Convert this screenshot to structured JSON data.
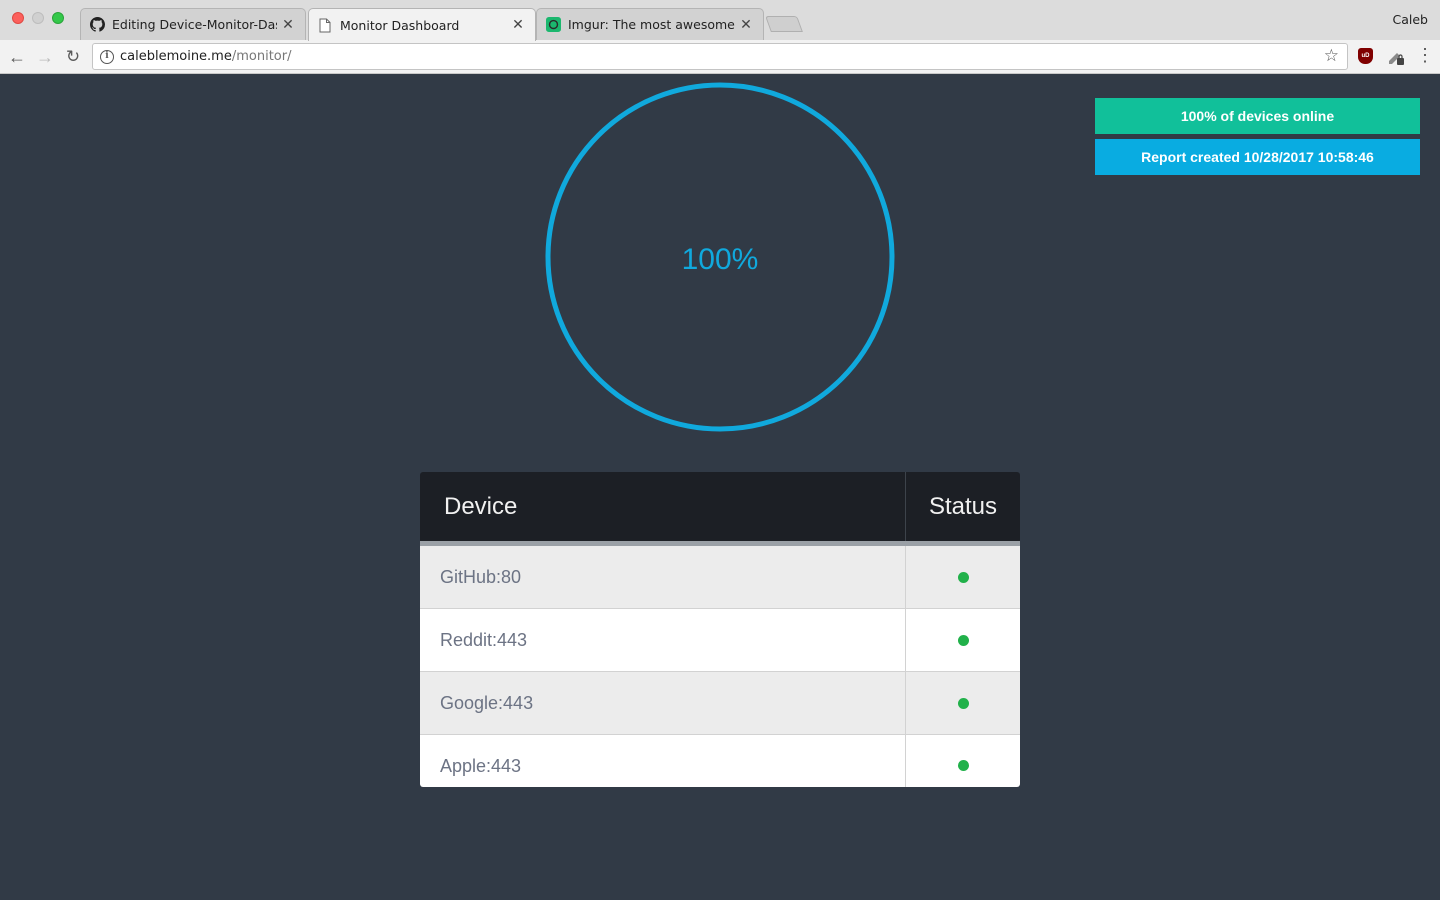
{
  "browser": {
    "tabs": [
      {
        "title": "Editing Device-Monitor-Dashboard",
        "icon": "github-icon",
        "active": false
      },
      {
        "title": "Monitor Dashboard",
        "icon": "document-icon",
        "active": true
      },
      {
        "title": "Imgur: The most awesome images on the Internet",
        "icon": "imgur-icon",
        "active": false
      }
    ],
    "profile_name": "Caleb",
    "url_host": "caleblemoine.me",
    "url_path": "/monitor/"
  },
  "dashboard": {
    "gauge_label": "100%",
    "online_fraction": 1.0,
    "online_badge": "100% of devices online",
    "report_badge": "Report created 10/28/2017 10:58:46",
    "colors": {
      "gauge": "#10a9dd",
      "online_badge": "#11c09a",
      "report_badge": "#09ace1",
      "status_ok": "#21b14a"
    }
  },
  "table": {
    "headers": {
      "device": "Device",
      "status": "Status"
    },
    "rows": [
      {
        "device": "GitHub:80",
        "status": "online"
      },
      {
        "device": "Reddit:443",
        "status": "online"
      },
      {
        "device": "Google:443",
        "status": "online"
      },
      {
        "device": "Apple:443",
        "status": "online"
      }
    ]
  }
}
